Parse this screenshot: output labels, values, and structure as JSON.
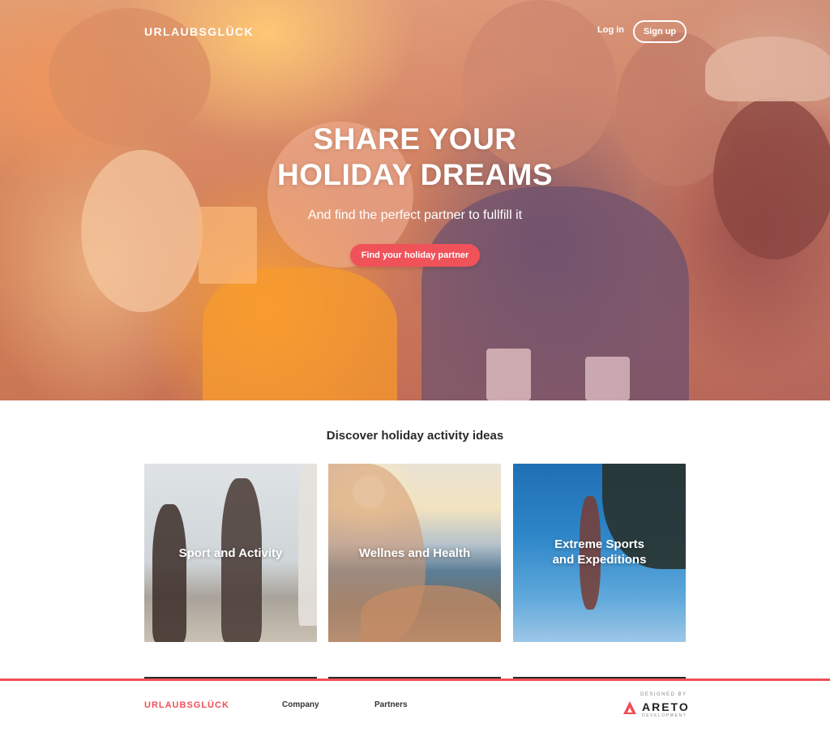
{
  "header": {
    "brand": "URLAUBSGLÜCK",
    "login_label": "Log in",
    "signup_label": "Sign up"
  },
  "hero": {
    "headline_line1": "SHARE YOUR",
    "headline_line2": "HOLIDAY DREAMS",
    "subline": "And find the perfect partner to fullfill it",
    "cta_label": "Find your holiday partner"
  },
  "section": {
    "title": "Discover holiday activity ideas",
    "cards": [
      {
        "label": "Sport and Activity"
      },
      {
        "label": "Wellnes and Health"
      },
      {
        "label_line1": "Extreme Sports",
        "label_line2": "and Expeditions"
      }
    ]
  },
  "footer": {
    "brand": "URLAUBSGLÜCK",
    "links": [
      "Company",
      "Partners"
    ],
    "designed_by": "DESIGNED BY",
    "studio_name": "ARETO",
    "studio_sub": "DEVELOPMENT"
  },
  "colors": {
    "accent": "#f0525a",
    "text_dark": "#2a2a2a",
    "white": "#ffffff"
  }
}
